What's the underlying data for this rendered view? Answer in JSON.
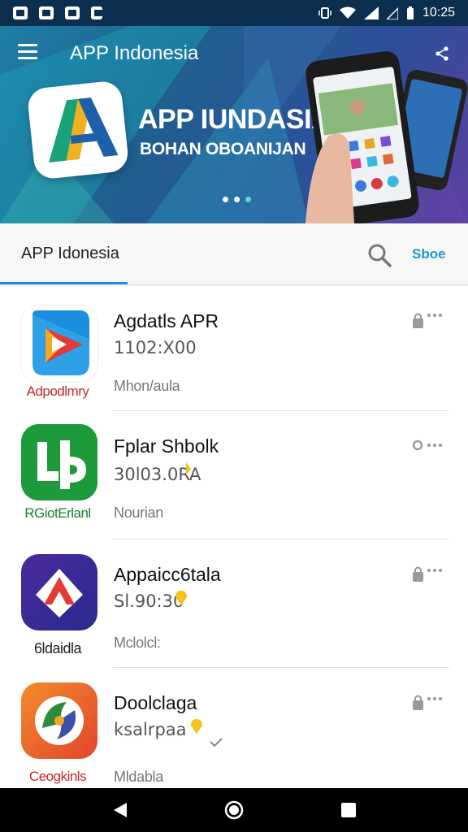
{
  "status_bar": {
    "time": "10:25"
  },
  "header": {
    "title": "APP Indonesia"
  },
  "banner": {
    "headline": "APP IUNDASIA",
    "subtitle": "BOHAN OBOANIJAN"
  },
  "tabs": {
    "active_label": "APP Idonesia",
    "sort_label": "Sboe"
  },
  "apps": [
    {
      "name": "Agdatls APR",
      "price": "1102:X00",
      "subtitle": "Mhon/aula",
      "caption": "Adpodlmry",
      "caption_color": "#c62828"
    },
    {
      "name": "Fplar Shbolk",
      "price": "30l03.0RA",
      "subtitle": "Nourian",
      "caption": "RGiotErlanl",
      "caption_color": "#1b7d2d"
    },
    {
      "name": "Appaicc6tala",
      "price": "Sl.90:30",
      "subtitle": "Mclolcl:",
      "caption": "6ldaidla",
      "caption_color": "#222222"
    },
    {
      "name": "Doolclaga",
      "price": "ksalrpaa",
      "subtitle": "Mldabla",
      "caption": "Ceogkinls",
      "caption_color": "#c62828"
    }
  ]
}
